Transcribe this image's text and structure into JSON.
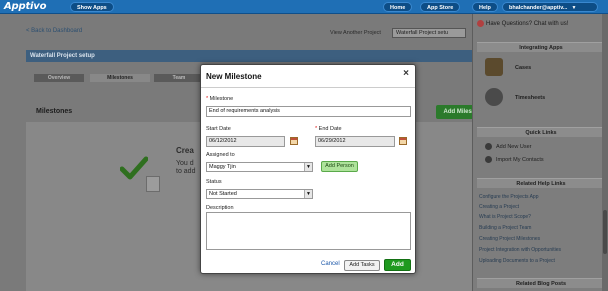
{
  "topbar": {
    "logo": "Apptivo",
    "show_apps": "Show Apps",
    "home": "Home",
    "app_store": "App Store",
    "help": "Help",
    "user": "bhalchander@apptiv..."
  },
  "page": {
    "back_link": "< Back to Dashboard",
    "view_another": "View Another Project",
    "project_select": "Waterfall Project setu",
    "panel_title": "Waterfall Project setup",
    "tabs": [
      "Overview",
      "Milestones",
      "Team"
    ],
    "milestones_heading": "Milestones",
    "add_milestone": "Add Milestone",
    "create_heading": "Crea",
    "create_line1": "You d",
    "create_line2": "to add"
  },
  "sidebar": {
    "chat": "Have Questions? Chat with us!",
    "integrating_apps": "Integrating Apps",
    "apps": [
      "Cases",
      "Timesheets"
    ],
    "quick_links": "Quick Links",
    "quick_items": [
      "Add New User",
      "Import My Contacts"
    ],
    "related_help": "Related Help Links",
    "help_links": [
      "Configure the Projects App",
      "Creating a Project",
      "What is Project Scope?",
      "Building a Project Team",
      "Creating Project Milestones",
      "Project Integration with Opportunities",
      "Uploading Documents to a Project"
    ],
    "related_blog": "Related Blog Posts"
  },
  "modal": {
    "title": "New Milestone",
    "close": "×",
    "milestone_label": "Milestone",
    "milestone_value": "End of requirements analysis",
    "start_label": "Start Date",
    "start_value": "06/12/2012",
    "end_label": "End Date",
    "end_value": "06/29/2012",
    "assigned_label": "Assigned to",
    "assigned_value": "Maggy Tjin",
    "add_person": "Add Person",
    "status_label": "Status",
    "status_value": "Not Started",
    "description_label": "Description",
    "description_value": "",
    "cancel": "Cancel",
    "add_tasks": "Add Tasks",
    "add": "Add"
  },
  "colors": {
    "topbar": "#1f6fb5",
    "add_button": "#1f9a1f",
    "add_person": "#aee39b",
    "required": "#dd1111"
  },
  "icons": {
    "calendar": "calendar-icon",
    "dropdown": "chevron-down-icon",
    "close": "close-icon",
    "check": "check-icon"
  }
}
